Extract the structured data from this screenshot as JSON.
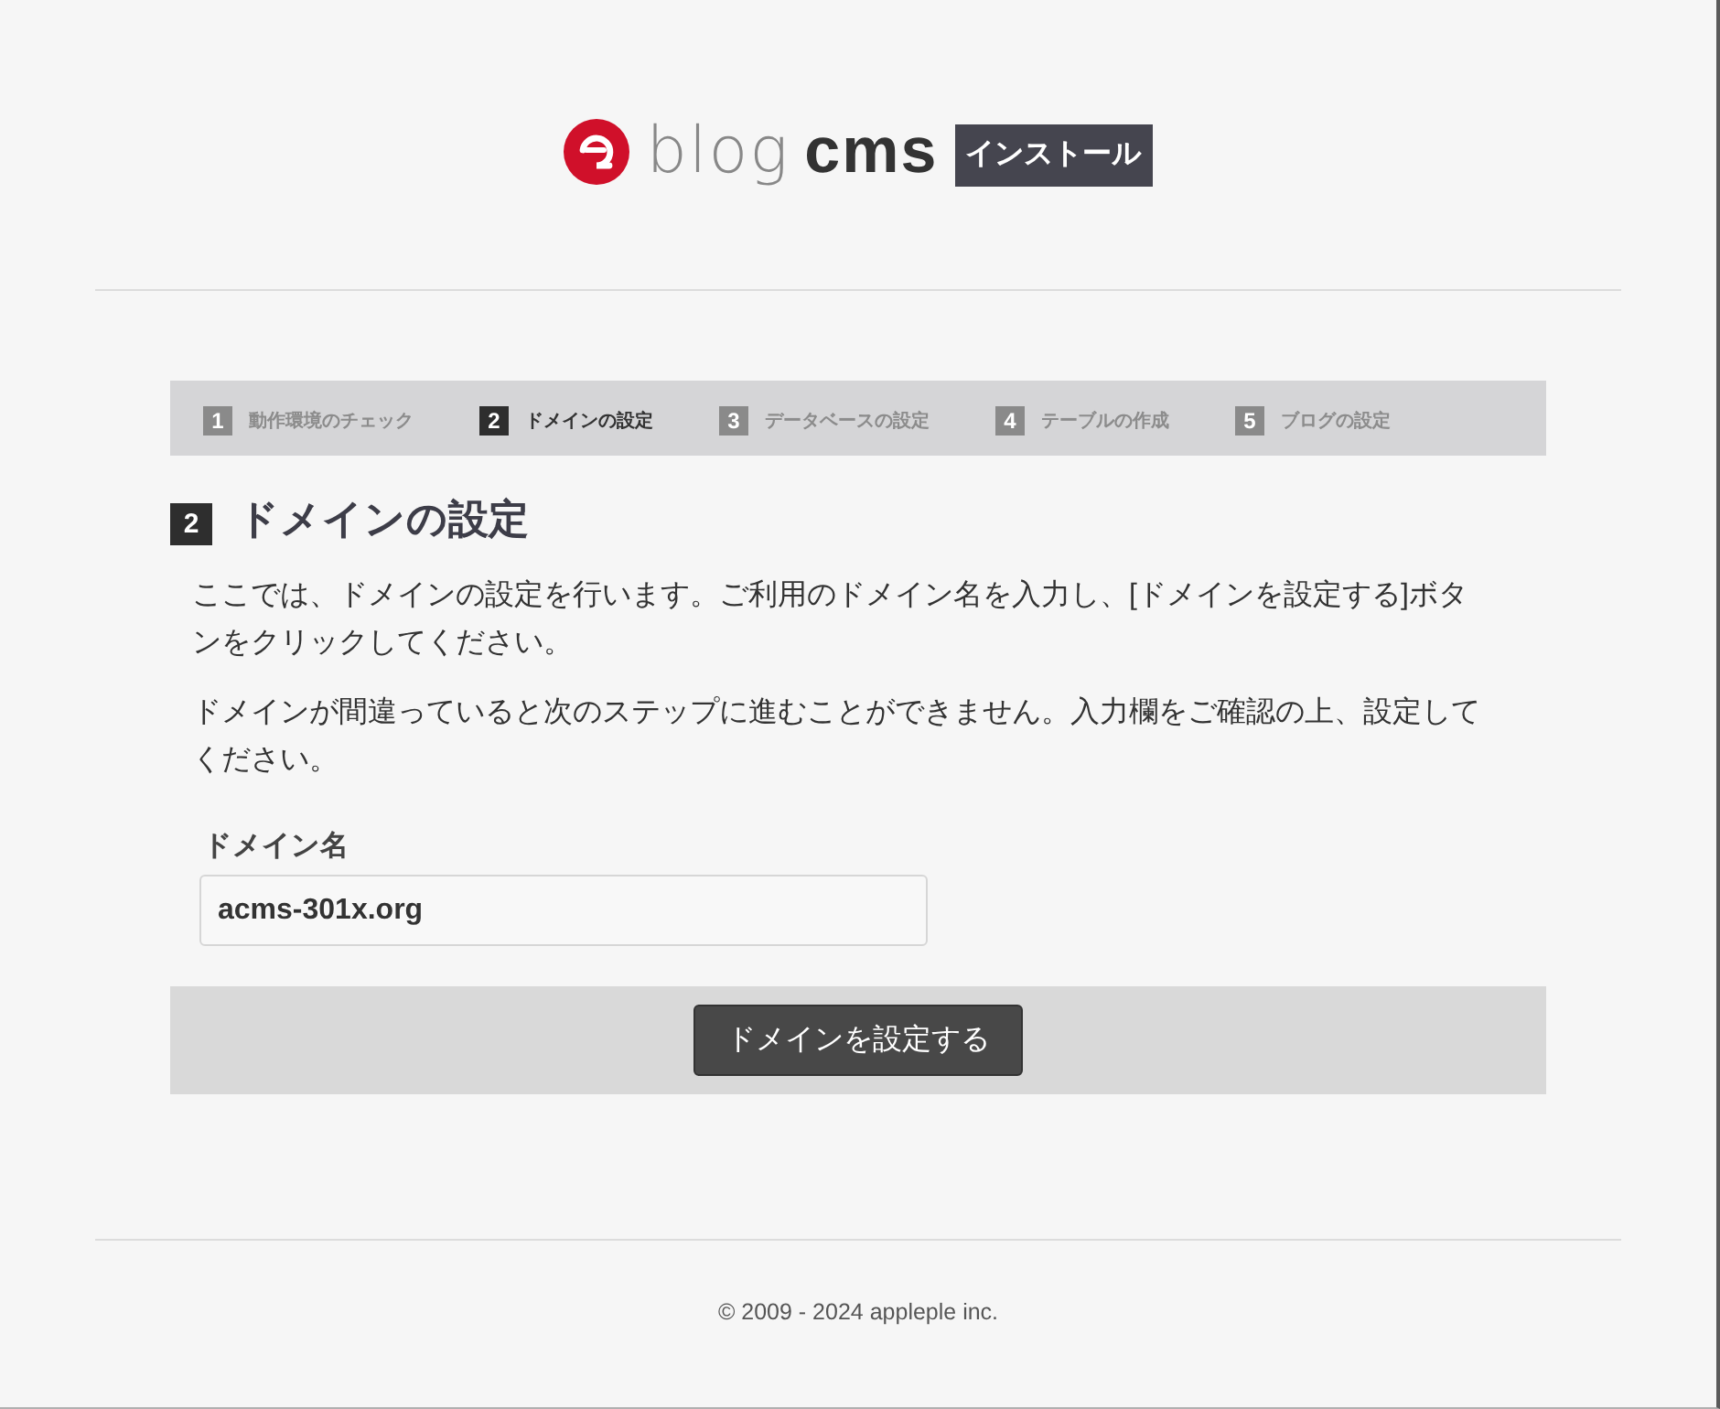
{
  "logo": {
    "word_light": "blog",
    "word_bold": "cms",
    "badge": "インストール"
  },
  "steps": [
    {
      "number": "1",
      "label": "動作環境のチェック",
      "selected": false
    },
    {
      "number": "2",
      "label": "ドメインの設定",
      "selected": true
    },
    {
      "number": "3",
      "label": "データベースの設定",
      "selected": false
    },
    {
      "number": "4",
      "label": "テーブルの作成",
      "selected": false
    },
    {
      "number": "5",
      "label": "ブログの設定",
      "selected": false
    }
  ],
  "heading": {
    "number": "2",
    "title": "ドメインの設定"
  },
  "paragraphs": [
    "ここでは、ドメインの設定を行います。ご利用のドメイン名を入力し、[ドメインを設定する]ボタンをクリックしてください。",
    "ドメインが間違っていると次のステップに進むことができません。入力欄をご確認の上、設定してください。"
  ],
  "field": {
    "label": "ドメイン名",
    "value": "acms-301x.org"
  },
  "submit_button": "ドメインを設定する",
  "footer": "© 2009 - 2024 appleple inc."
}
